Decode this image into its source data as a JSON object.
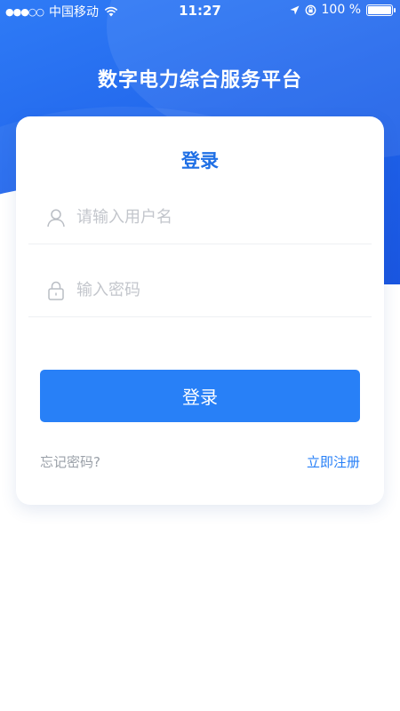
{
  "status_bar": {
    "signal_dots": "●●●○○",
    "carrier": "中国移动",
    "time": "11:27",
    "battery_percent": "100 %",
    "battery_level": 1.0
  },
  "app": {
    "title": "数字电力综合服务平台"
  },
  "login_card": {
    "title": "登录",
    "username_placeholder": "请输入用户名",
    "username_value": "",
    "password_placeholder": "输入密码",
    "password_value": "",
    "login_button_label": "登录",
    "forgot_password_label": "忘记密码?",
    "register_label": "立即注册"
  },
  "icons": {
    "username": "user-icon",
    "password": "lock-icon"
  },
  "colors": {
    "primary": "#2880f7",
    "header_blue": "#1f63ea",
    "title_blue": "#1f6fe5",
    "muted_text": "#9aa0a8",
    "placeholder": "#c3c6cc"
  }
}
